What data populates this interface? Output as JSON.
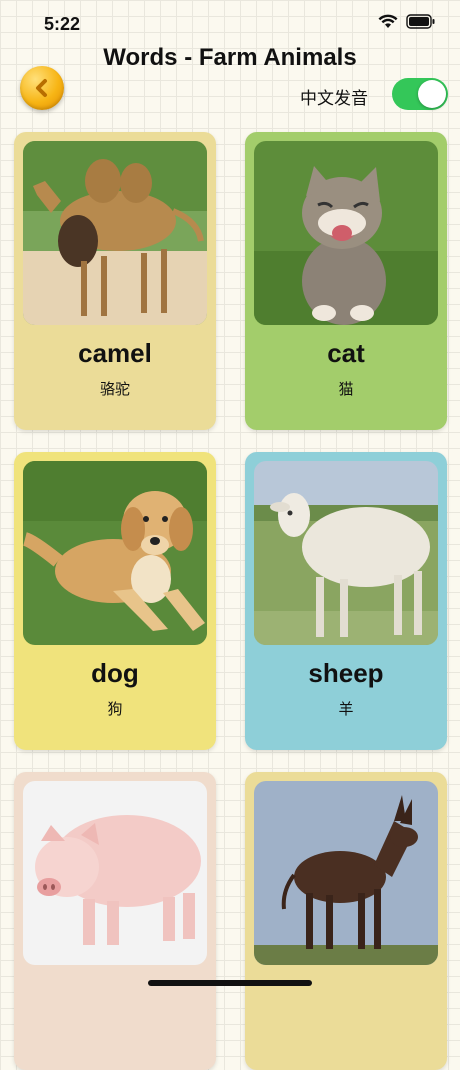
{
  "status": {
    "time": "5:22"
  },
  "header": {
    "title": "Words - Farm Animals",
    "toggle_label": "中文发音",
    "toggle_on": true
  },
  "cards": [
    {
      "word": "camel",
      "cn": "骆驼",
      "bg": "#ebdc98"
    },
    {
      "word": "cat",
      "cn": "猫",
      "bg": "#a3cd6b"
    },
    {
      "word": "dog",
      "cn": "狗",
      "bg": "#f0e37c"
    },
    {
      "word": "sheep",
      "cn": "羊",
      "bg": "#8ecfd8"
    },
    {
      "word": "",
      "cn": "",
      "bg": "#f0dccc"
    },
    {
      "word": "",
      "cn": "",
      "bg": "#ebdc98"
    }
  ],
  "colors": {
    "accent": "#34c759",
    "back": "#f7b515"
  }
}
